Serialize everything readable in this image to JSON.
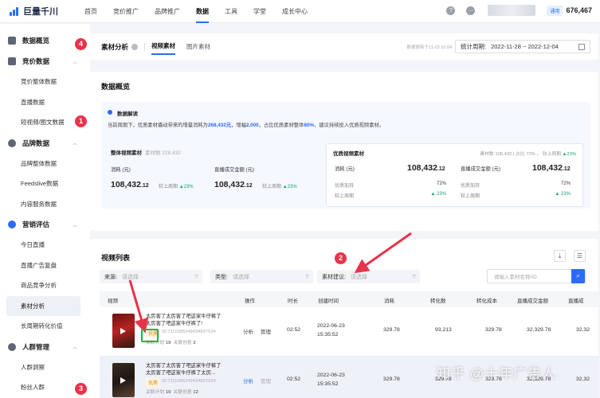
{
  "topbar": {
    "logo_text": "巨量千川",
    "nav": [
      {
        "label": "首页",
        "active": false
      },
      {
        "label": "竞价推广",
        "active": false
      },
      {
        "label": "品牌推广",
        "active": false
      },
      {
        "label": "数据",
        "active": true
      },
      {
        "label": "工具",
        "active": false
      },
      {
        "label": "学堂",
        "active": false
      },
      {
        "label": "成长中心",
        "active": false
      }
    ],
    "help_icon": "question-icon",
    "more_icon": "more-icon",
    "account_badge": "通用",
    "account_balance": "676,467"
  },
  "sidebar": {
    "groups": [
      {
        "label": "数据概览",
        "icon": "overview-icon",
        "items": []
      },
      {
        "label": "竞价数据",
        "icon": "bid-icon",
        "items": [
          "竞价整体数据",
          "直播数据",
          "短视频/图文数据"
        ]
      },
      {
        "label": "品牌数据",
        "icon": "brand-icon",
        "items": [
          "品牌整体数据",
          "Feedslive数据",
          "内容服务数据"
        ]
      },
      {
        "label": "营销评估",
        "icon": "marketing-icon",
        "items": [
          "今日直播",
          "直播广告复盘",
          "商品竞争分析",
          "素材分析",
          "长周期转化价值"
        ]
      },
      {
        "label": "人群管理",
        "icon": "audience-icon",
        "items": [
          "人群洞察",
          "粉丝人群"
        ]
      }
    ],
    "active_item": "素材分析"
  },
  "header": {
    "title": "素材分析",
    "tabs": [
      "视频素材",
      "图片素材"
    ],
    "active_tab": "视频素材",
    "update_time": "数据更新于11-23 10:04",
    "period_label": "统计周期:",
    "period_value": "2022-11-28 ~ 2022-12-04"
  },
  "overview": {
    "title": "数据概览",
    "insight_title": "数据解读",
    "insight_text_parts": [
      "当前周期下，优质素材撬动带来的增量消耗为",
      "268,432元",
      "，增幅",
      "2,000",
      "，占比优质素材整体",
      "80%",
      "，建议持续投入优质视频素材。"
    ],
    "whole": {
      "title": "整体视频素材",
      "count_label": "素材数 228,432",
      "metrics": [
        {
          "label": "消耗 (元)",
          "int": "108,432",
          "dec": ".12",
          "cmp_label": "较上周期",
          "cmp_value": "23%"
        },
        {
          "label": "直播成交金额 (元)",
          "int": "108,432",
          "dec": ".12",
          "cmp_label": "较上周期",
          "cmp_value": "23%"
        }
      ]
    },
    "good": {
      "title": "优质视频素材",
      "sub": "素材数 108,432 | 占比 72% ， 较上周期",
      "sub_up": "23%",
      "metrics": [
        {
          "label": "消耗 (元)",
          "int": "108,432",
          "dec": ".12",
          "share_label": "优质加持",
          "share_value": "72%",
          "cmp_label": "较上周期",
          "cmp_value": "23%"
        },
        {
          "label": "直播成交金额 (元)",
          "int": "108,432",
          "dec": ".12",
          "share_label": "优质加持",
          "share_value": "72%",
          "cmp_label": "较上周期",
          "cmp_value": "23%"
        }
      ]
    }
  },
  "video_list": {
    "title": "视频列表",
    "download_icon": "download-icon",
    "settings_icon": "column-settings-icon",
    "filters": [
      {
        "label": "来源:",
        "placeholder": "请选择"
      },
      {
        "label": "类型:",
        "placeholder": "请选择"
      },
      {
        "label": "素材建议:",
        "placeholder": "请选择"
      }
    ],
    "search_placeholder": "请输入素材名称/ID",
    "columns": [
      "视频",
      "操作",
      "时长",
      "创建时间",
      "消耗",
      "转化数",
      "转化成本",
      "直播成交金额",
      "直播成"
    ],
    "rows": [
      {
        "title": "太厉害了太厉害了吧这家牛仔裤了太厉害了吧这家牛仔裤了!",
        "badge": "优质",
        "id": "ID:7111995249434837024",
        "plan_label": "关联计划",
        "plan_count": "19",
        "creative_label": "关联创意",
        "creative_count": "2",
        "ops": [
          "分析",
          "管理"
        ],
        "duration": "02:52",
        "date": "2022-06-23",
        "time": "15:35:52",
        "cost": "329.78",
        "conv": "93,213",
        "conv_cost": "329.78",
        "gmv": "32,329.78",
        "gmv2": "32,32"
      },
      {
        "title": "太厉害了太厉害了吧这家牛仔裤了太厉害了吧这家牛仔裤了太厉...",
        "badge": "优质",
        "id": "ID:7111995249434837024",
        "plan_label": "关联计划",
        "plan_count": "19",
        "creative_label": "关联创意",
        "creative_count": "12",
        "ops": [
          "分析",
          "管理"
        ],
        "duration": "02:52",
        "date": "2022-06-23",
        "time": "15:35:52",
        "cost": "329.78",
        "conv": "329.78",
        "conv_cost": "329.78",
        "gmv": "32,329.78",
        "gmv2": "32,32"
      }
    ]
  },
  "annotations": [
    "1",
    "2",
    "3",
    "4"
  ],
  "watermark": "知乎 @十年广告人",
  "colors": {
    "accent": "#2a6cf6",
    "annotation": "#e8334a",
    "up": "#1aa06d",
    "highlight_box": "#22b14c"
  }
}
